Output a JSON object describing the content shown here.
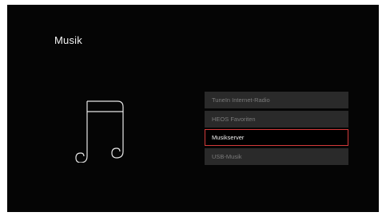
{
  "screen": {
    "title": "Musik"
  },
  "menu": {
    "items": [
      {
        "label": "TuneIn Internet-Radio",
        "selected": false
      },
      {
        "label": "HEOS Favoriten",
        "selected": false
      },
      {
        "label": "Musikserver",
        "selected": true
      },
      {
        "label": "USB-Musik",
        "selected": false
      }
    ]
  },
  "icons": {
    "main": "music-note-icon"
  },
  "colors": {
    "background": "#050505",
    "item_background": "#2a2a2a",
    "item_text": "#7a7a7a",
    "selected_text": "#f2f2f2",
    "selected_border": "#d33a3a"
  }
}
